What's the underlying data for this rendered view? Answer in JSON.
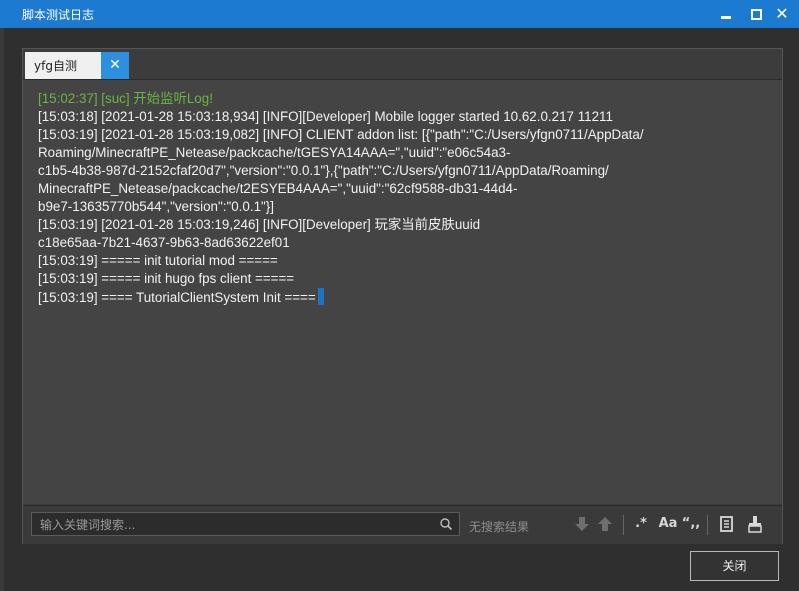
{
  "window": {
    "title": "脚本测试日志"
  },
  "tabs": [
    {
      "label": "yfg自测",
      "close_icon": "close-icon"
    }
  ],
  "log_lines": [
    "[15:02:37] [suc] 开始监听Log!",
    "[15:03:18] [2021-01-28 15:03:18,934] [INFO][Developer] Mobile logger started 10.62.0.217 11211",
    "[15:03:19] [2021-01-28 15:03:19,082] [INFO] CLIENT addon list: [{\"path\":\"C:/Users/yfgn0711/AppData/",
    "Roaming/MinecraftPE_Netease/packcache/tGESYA14AAA=\",\"uuid\":\"e06c54a3-",
    "c1b5-4b38-987d-2152cfaf20d7\",\"version\":\"0.0.1\"},{\"path\":\"C:/Users/yfgn0711/AppData/Roaming/",
    "MinecraftPE_Netease/packcache/t2ESYEB4AAA=\",\"uuid\":\"62cf9588-db31-44d4-",
    "b9e7-13635770b544\",\"version\":\"0.0.1\"}]",
    "[15:03:19] [2021-01-28 15:03:19,246] [INFO][Developer] 玩家当前皮肤uuid",
    "c18e65aa-7b21-4637-9b63-8ad63622ef01",
    "[15:03:19] ===== init tutorial mod =====",
    "[15:03:19] ===== init hugo fps client =====",
    "[15:03:19] ==== TutorialClientSystem Init ===="
  ],
  "search": {
    "placeholder": "输入关键词搜索...",
    "no_result": "无搜索结果",
    "regex_label": ".*",
    "case_label": "Aa",
    "quote_label": "“,,"
  },
  "footer": {
    "close_label": "关闭"
  },
  "colors": {
    "titlebar": "#1c7ad0",
    "success_text": "#6ab543",
    "tab_close": "#2d8fe0"
  }
}
